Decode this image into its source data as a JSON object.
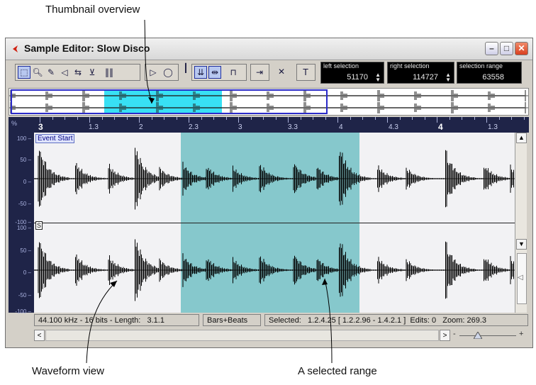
{
  "annotations": {
    "thumbnail_overview": "Thumbnail overview",
    "waveform_view": "Waveform view",
    "selected_range": "A selected range"
  },
  "window": {
    "title": "Sample Editor: Slow Disco",
    "controls": {
      "minimize": "–",
      "maximize": "□",
      "close": "✕"
    }
  },
  "toolbar": {
    "tools": [
      "range-select-tool",
      "zoom-tool",
      "pencil-tool",
      "speaker-tool",
      "scrub-tool",
      "hitpoint-tool",
      "grid-tool",
      "play-button",
      "loop-button",
      "level-indicator",
      "snap-button",
      "view-button",
      "range-button",
      "quantize-button",
      "show-hitpoints-button",
      "hitpoint-slider-icon"
    ],
    "left_selection": {
      "label": "left selection",
      "value": "51170"
    },
    "right_selection": {
      "label": "right selection",
      "value": "114727"
    },
    "selection_range": {
      "label": "selection range",
      "value": "63558"
    }
  },
  "ruler": {
    "labels": [
      "3",
      "1.3",
      "2",
      "2.3",
      "3",
      "3.3",
      "4",
      "4.3",
      "4",
      "1.3"
    ],
    "major": [
      0,
      8
    ],
    "y_label": "%"
  },
  "y_axis": {
    "top": [
      "100",
      "50",
      "0",
      "-50",
      "-100"
    ],
    "bottom": [
      "100",
      "50",
      "0",
      "-50",
      "-100"
    ]
  },
  "waveform": {
    "event_start": "Event Start",
    "s_marker": "S",
    "selection_color": "#86c8cc",
    "overview_selection_color": "#38e0f4"
  },
  "status": {
    "format": "44.100 kHz - 16 bits - Length:",
    "length": "3.1.1",
    "display": "Bars+Beats",
    "selected_label": "Selected:",
    "selected_value": "1.2.4.25 [   1.2.2.96 -   1.4.2.1 ]",
    "edits": "Edits: 0",
    "zoom": "Zoom: 269.3"
  },
  "scrollbar": {
    "left": "<",
    "right": ">",
    "zoom_minus": "-",
    "zoom_plus": "+"
  }
}
